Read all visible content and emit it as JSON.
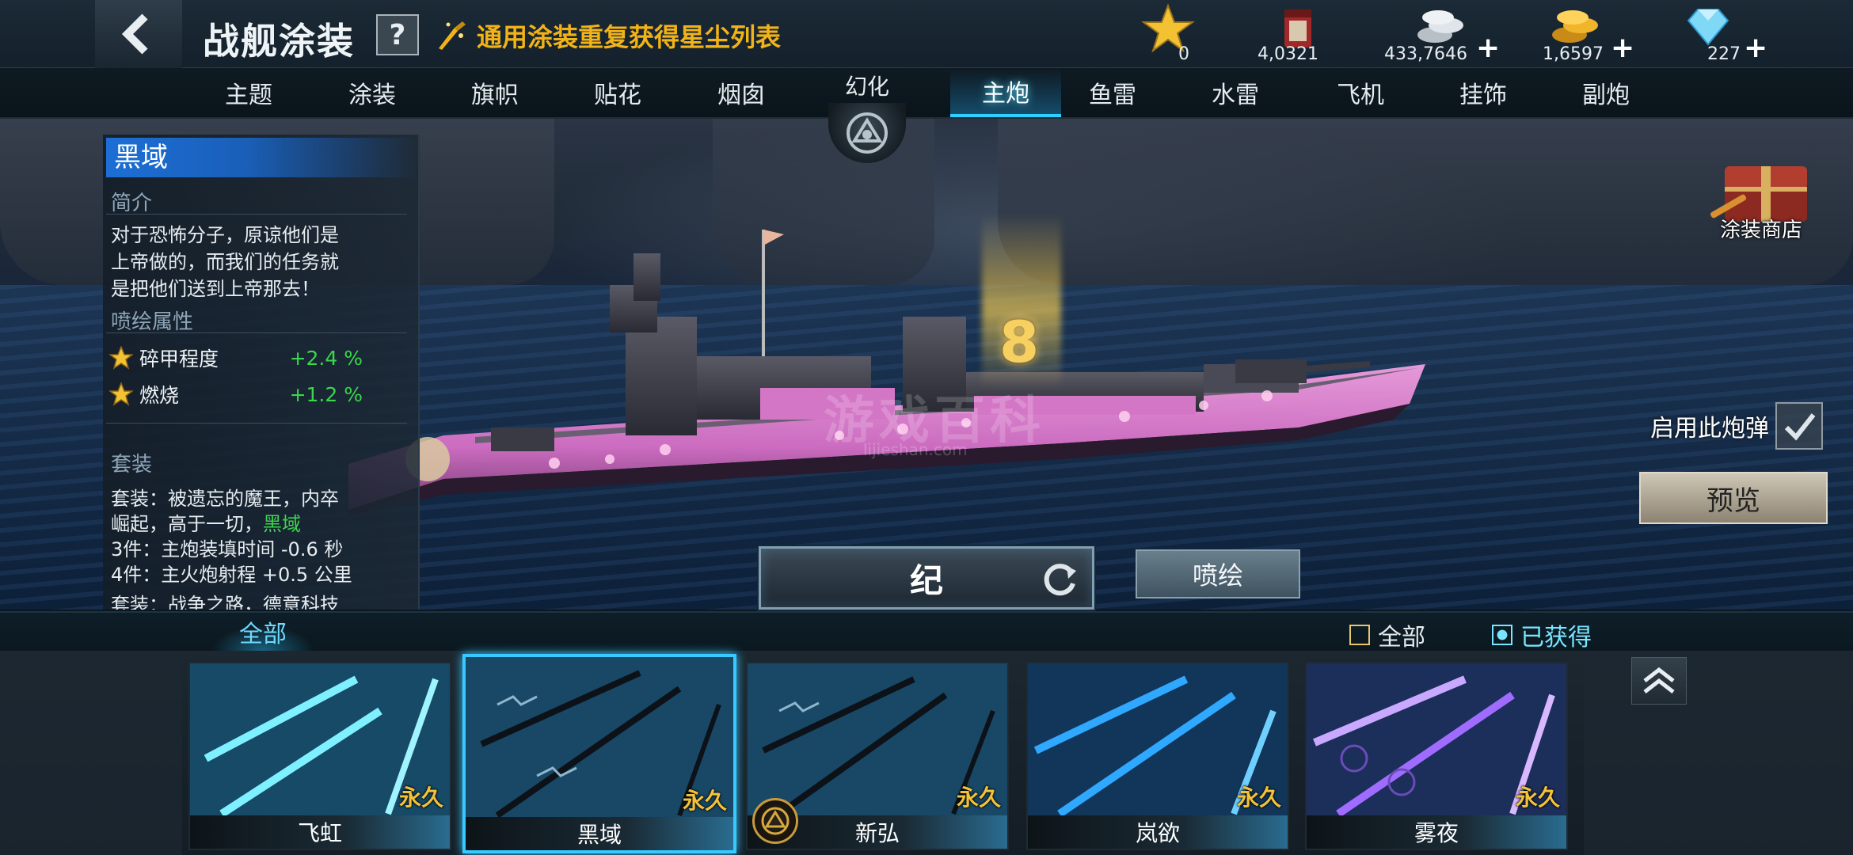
{
  "header": {
    "title": "战舰涂装",
    "help_label": "?",
    "stardust_link": "通用涂装重复获得星尘列表",
    "currencies": [
      {
        "icon": "star-icon",
        "value": "0",
        "plus": ""
      },
      {
        "icon": "paint-bucket-icon",
        "value": "4,0321",
        "plus": ""
      },
      {
        "icon": "silver-coins-icon",
        "value": "433,7646",
        "plus": "+"
      },
      {
        "icon": "gold-coins-icon",
        "value": "1,6597",
        "plus": "+"
      },
      {
        "icon": "diamond-icon",
        "value": "227",
        "plus": "+"
      }
    ]
  },
  "tabs": [
    {
      "label": "主题",
      "active": false
    },
    {
      "label": "涂装",
      "active": false
    },
    {
      "label": "旗帜",
      "active": false
    },
    {
      "label": "贴花",
      "active": false
    },
    {
      "label": "烟囱",
      "active": false
    },
    {
      "label": "主炮",
      "active": true
    },
    {
      "label": "鱼雷",
      "active": false
    },
    {
      "label": "水雷",
      "active": false
    },
    {
      "label": "飞机",
      "active": false
    },
    {
      "label": "挂饰",
      "active": false
    },
    {
      "label": "副炮",
      "active": false
    }
  ],
  "phantom_tab": {
    "label": "幻化"
  },
  "info": {
    "name": "黑域",
    "intro_title": "简介",
    "intro_lines": [
      "对于恐怖分子，原谅他们是",
      "上帝做的，而我们的任务就",
      "是把他们送到上帝那去！"
    ],
    "attr_title": "喷绘属性",
    "attributes": [
      {
        "name": "碎甲程度",
        "bonus": "+2.4 %"
      },
      {
        "name": "燃烧",
        "bonus": "+1.2 %"
      }
    ],
    "set_title": "套装",
    "set_line1": "套装：被遗忘的魔王，内卒",
    "set_line2_prefix": "崛起，高于一切，",
    "set_line2_highlight": "黑域",
    "set_line3": "3件：主炮装填时间  -0.6 秒",
    "set_line4": "4件：主火炮射程  +0.5 公里",
    "set_line5": "套装：战争之路，德意科技"
  },
  "scene": {
    "rank_digit": "8",
    "watermark": "游戏百科",
    "watermark_url": "lijieshan.com"
  },
  "right_panel": {
    "paint_shop_label": "涂装商店",
    "use_shell_label": "启用此炮弹",
    "use_shell_checked": true,
    "preview_label": "预览"
  },
  "name_plate": {
    "name": "纪"
  },
  "spray_label": "喷绘",
  "filter": {
    "category_tab": "全部",
    "options": [
      {
        "label": "全部",
        "checked": false
      },
      {
        "label": "已获得",
        "checked": true
      }
    ]
  },
  "skins": [
    {
      "name": "飞虹",
      "tag": "永久",
      "selected": false,
      "phantom": false,
      "theme": "cyan"
    },
    {
      "name": "黑域",
      "tag": "永久",
      "selected": true,
      "phantom": false,
      "theme": "dark"
    },
    {
      "name": "新弘",
      "tag": "永久",
      "selected": false,
      "phantom": true,
      "theme": "dark"
    },
    {
      "name": "岚欲",
      "tag": "永久",
      "selected": false,
      "phantom": false,
      "theme": "blue"
    },
    {
      "name": "雾夜",
      "tag": "永久",
      "selected": false,
      "phantom": false,
      "theme": "purple"
    }
  ],
  "colors": {
    "accent": "#2fd0ff",
    "gold_text": "#f2b318",
    "bonus_green": "#3ad64c",
    "skin_pink": "#e27ad0"
  }
}
